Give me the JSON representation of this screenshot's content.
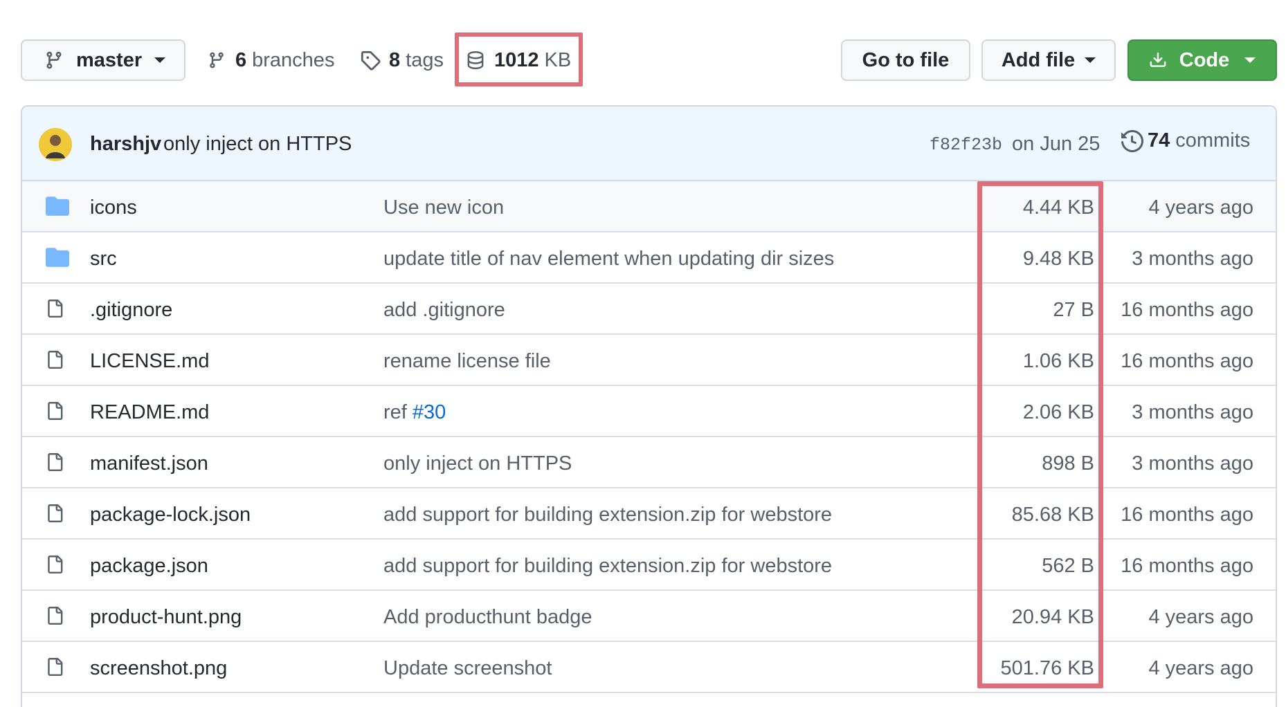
{
  "toolbar": {
    "branch_label": "master",
    "branches_count": "6",
    "branches_word": "branches",
    "tags_count": "8",
    "tags_word": "tags",
    "repo_size_value": "1012",
    "repo_size_unit": "KB",
    "go_to_file_label": "Go to file",
    "add_file_label": "Add file",
    "code_label": "Code"
  },
  "latest_commit": {
    "author": "harshjv",
    "message": "only inject on HTTPS",
    "sha": "f82f23b",
    "date": "on Jun 25",
    "commits_count": "74",
    "commits_word": "commits"
  },
  "files": [
    {
      "type": "folder",
      "name": "icons",
      "message": "Use new icon",
      "size": "4.44 KB",
      "age": "4 years ago"
    },
    {
      "type": "folder",
      "name": "src",
      "message": "update title of nav element when updating dir sizes",
      "size": "9.48 KB",
      "age": "3 months ago"
    },
    {
      "type": "file",
      "name": ".gitignore",
      "message": "add .gitignore",
      "size": "27 B",
      "age": "16 months ago"
    },
    {
      "type": "file",
      "name": "LICENSE.md",
      "message": "rename license file",
      "size": "1.06 KB",
      "age": "16 months ago"
    },
    {
      "type": "file",
      "name": "README.md",
      "message": "ref ",
      "message_link": "#30",
      "size": "2.06 KB",
      "age": "3 months ago"
    },
    {
      "type": "file",
      "name": "manifest.json",
      "message": "only inject on HTTPS",
      "size": "898 B",
      "age": "3 months ago"
    },
    {
      "type": "file",
      "name": "package-lock.json",
      "message": "add support for building extension.zip for webstore",
      "size": "85.68 KB",
      "age": "16 months ago"
    },
    {
      "type": "file",
      "name": "package.json",
      "message": "add support for building extension.zip for webstore",
      "size": "562 B",
      "age": "16 months ago"
    },
    {
      "type": "file",
      "name": "product-hunt.png",
      "message": "Add producthunt badge",
      "size": "20.94 KB",
      "age": "4 years ago"
    },
    {
      "type": "file",
      "name": "screenshot.png",
      "message": "Update screenshot",
      "size": "501.76 KB",
      "age": "4 years ago"
    }
  ],
  "colors": {
    "highlight": "#dd6e7a",
    "code_button": "#4aa54f",
    "folder_icon": "#79b8ff",
    "link": "#0969da",
    "commit_header_bg": "#eef6ff"
  }
}
